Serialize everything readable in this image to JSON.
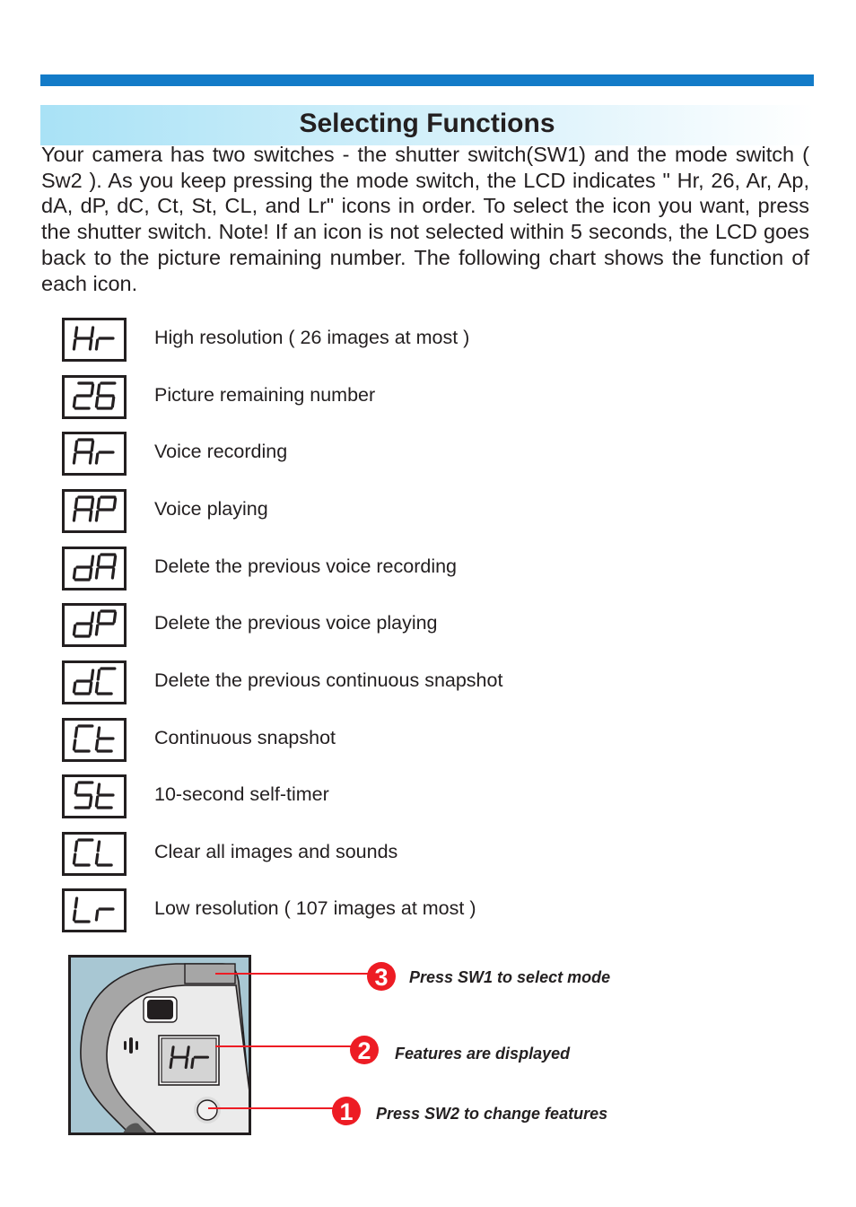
{
  "header": {
    "accent_color": "#137bc8",
    "title": "Selecting Functions"
  },
  "intro": {
    "text": "Your camera has two switches - the shutter switch(SW1) and the mode switch ( Sw2 ). As you keep pressing the mode switch, the LCD indicates \" Hr, 26, Ar, Ap, dA, dP, dC, Ct, St, CL, and Lr\"  icons in order. To select the icon you want, press the shutter switch. Note! If an icon is not selected within 5 seconds, the LCD goes back to the picture remaining number. The following chart shows the function of each icon."
  },
  "functions": [
    {
      "icon": "Hr",
      "label": "High resolution ( 26 images at most )"
    },
    {
      "icon": "26",
      "label": "Picture remaining number"
    },
    {
      "icon": "Ar",
      "label": "Voice recording"
    },
    {
      "icon": "AP",
      "label": "Voice playing"
    },
    {
      "icon": "dA",
      "label": "Delete the previous voice recording"
    },
    {
      "icon": "dP",
      "label": "Delete the previous voice playing"
    },
    {
      "icon": "dC",
      "label": "Delete the previous continuous snapshot"
    },
    {
      "icon": "Ct",
      "label": "Continuous snapshot"
    },
    {
      "icon": "St",
      "label": "10-second self-timer"
    },
    {
      "icon": "CL",
      "label": "Clear all images and sounds"
    },
    {
      "icon": "Lr",
      "label": "Low resolution ( 107 images at most )"
    }
  ],
  "diagram": {
    "lcd_display": "Hr",
    "callout_color": "#ed1c24",
    "callouts": [
      {
        "number": "3",
        "text": "Press SW1 to select mode"
      },
      {
        "number": "2",
        "text": "Features are  displayed"
      },
      {
        "number": "1",
        "text": "Press SW2 to change features"
      }
    ]
  }
}
